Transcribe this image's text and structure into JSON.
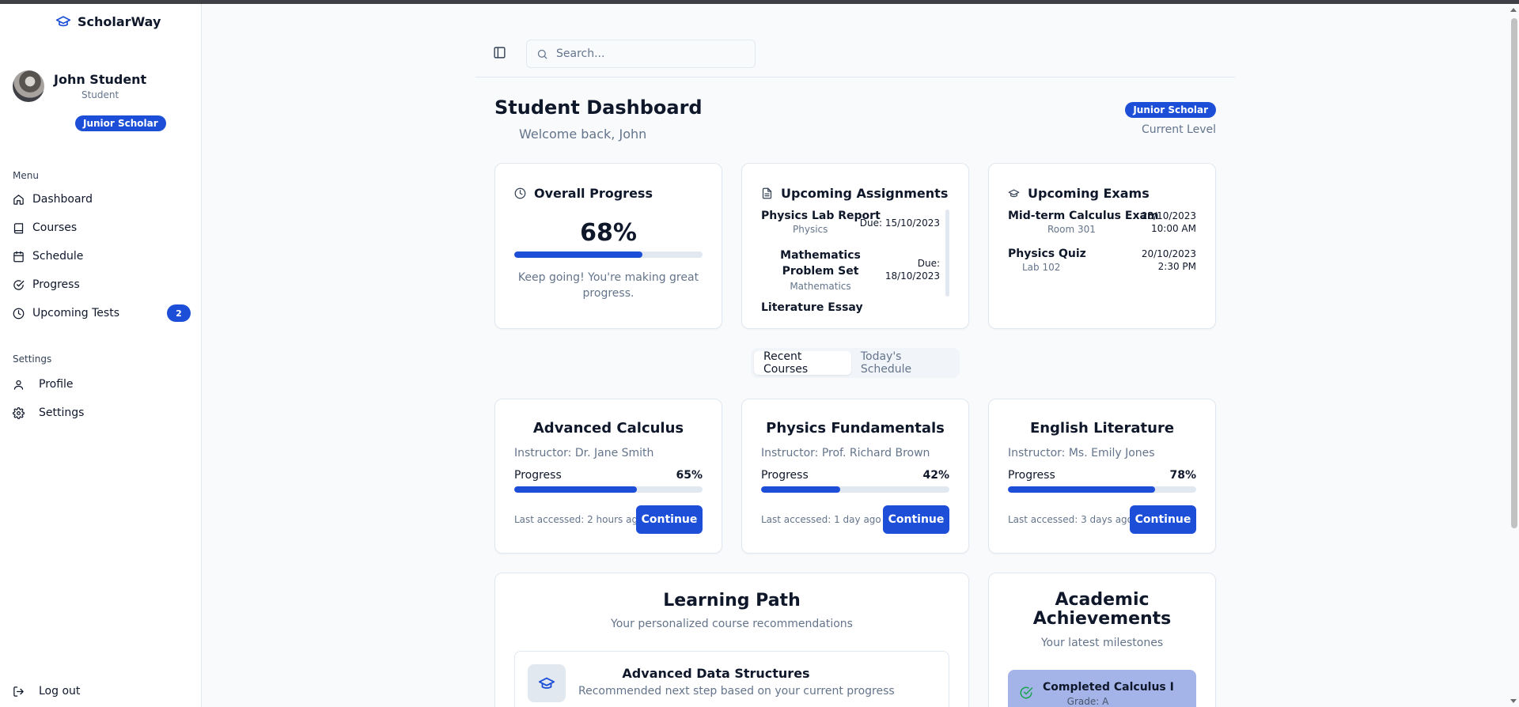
{
  "app": {
    "name": "ScholarWay"
  },
  "user": {
    "name": "John Student",
    "role": "Student",
    "level": "Junior Scholar"
  },
  "sidebar": {
    "menu_title": "Menu",
    "menu": [
      {
        "label": "Dashboard",
        "icon": "home-icon"
      },
      {
        "label": "Courses",
        "icon": "book-icon"
      },
      {
        "label": "Schedule",
        "icon": "calendar-icon"
      },
      {
        "label": "Progress",
        "icon": "check-circle-icon"
      },
      {
        "label": "Upcoming Tests",
        "icon": "clock-icon",
        "badge": "2"
      }
    ],
    "settings_title": "Settings",
    "settings": [
      {
        "label": "Profile",
        "icon": "user-icon"
      },
      {
        "label": "Settings",
        "icon": "gear-icon"
      }
    ],
    "logout": "Log out"
  },
  "header": {
    "search_placeholder": "Search..."
  },
  "page": {
    "title": "Student Dashboard",
    "welcome": "Welcome back, John",
    "level_badge": "Junior Scholar",
    "level_label": "Current Level"
  },
  "overall_progress": {
    "title": "Overall Progress",
    "value": "68%",
    "fraction": 0.68,
    "message": "Keep going! You're making great progress."
  },
  "assignments": {
    "title": "Upcoming Assignments",
    "items": [
      {
        "title": "Physics Lab Report",
        "subject": "Physics",
        "due": "Due: 15/10/2023"
      },
      {
        "title": "Mathematics Problem Set",
        "subject": "Mathematics",
        "due": "Due: 18/10/2023"
      },
      {
        "title": "Literature Essay",
        "subject": "",
        "due": ""
      }
    ]
  },
  "exams": {
    "title": "Upcoming Exams",
    "items": [
      {
        "title": "Mid-term Calculus Exam",
        "location": "Room 301",
        "date": "25/10/2023",
        "time": "10:00 AM"
      },
      {
        "title": "Physics Quiz",
        "location": "Lab 102",
        "date": "20/10/2023",
        "time": "2:30 PM"
      }
    ]
  },
  "tabs": [
    "Recent Courses",
    "Today's Schedule"
  ],
  "courses": [
    {
      "title": "Advanced Calculus",
      "instructor": "Instructor: Dr. Jane Smith",
      "progress_label": "Progress",
      "progress": "65%",
      "fraction": 0.65,
      "last": "Last accessed: 2 hours ago",
      "button": "Continue"
    },
    {
      "title": "Physics Fundamentals",
      "instructor": "Instructor: Prof. Richard Brown",
      "progress_label": "Progress",
      "progress": "42%",
      "fraction": 0.42,
      "last": "Last accessed: 1 day ago",
      "button": "Continue"
    },
    {
      "title": "English Literature",
      "instructor": "Instructor: Ms. Emily Jones",
      "progress_label": "Progress",
      "progress": "78%",
      "fraction": 0.78,
      "last": "Last accessed: 3 days ago",
      "button": "Continue"
    }
  ],
  "learning_path": {
    "title": "Learning Path",
    "subtitle": "Your personalized course recommendations",
    "item": {
      "title": "Advanced Data Structures",
      "description": "Recommended next step based on your current progress"
    }
  },
  "achievements": {
    "title_line1": "Academic",
    "title_line2": "Achievements",
    "subtitle": "Your latest milestones",
    "item": {
      "title": "Completed Calculus I",
      "subtitle": "Grade: A"
    }
  },
  "colors": {
    "accent": "#1d4ed8",
    "achievement_bg": "#a5b4e8",
    "success": "#16a34a"
  }
}
